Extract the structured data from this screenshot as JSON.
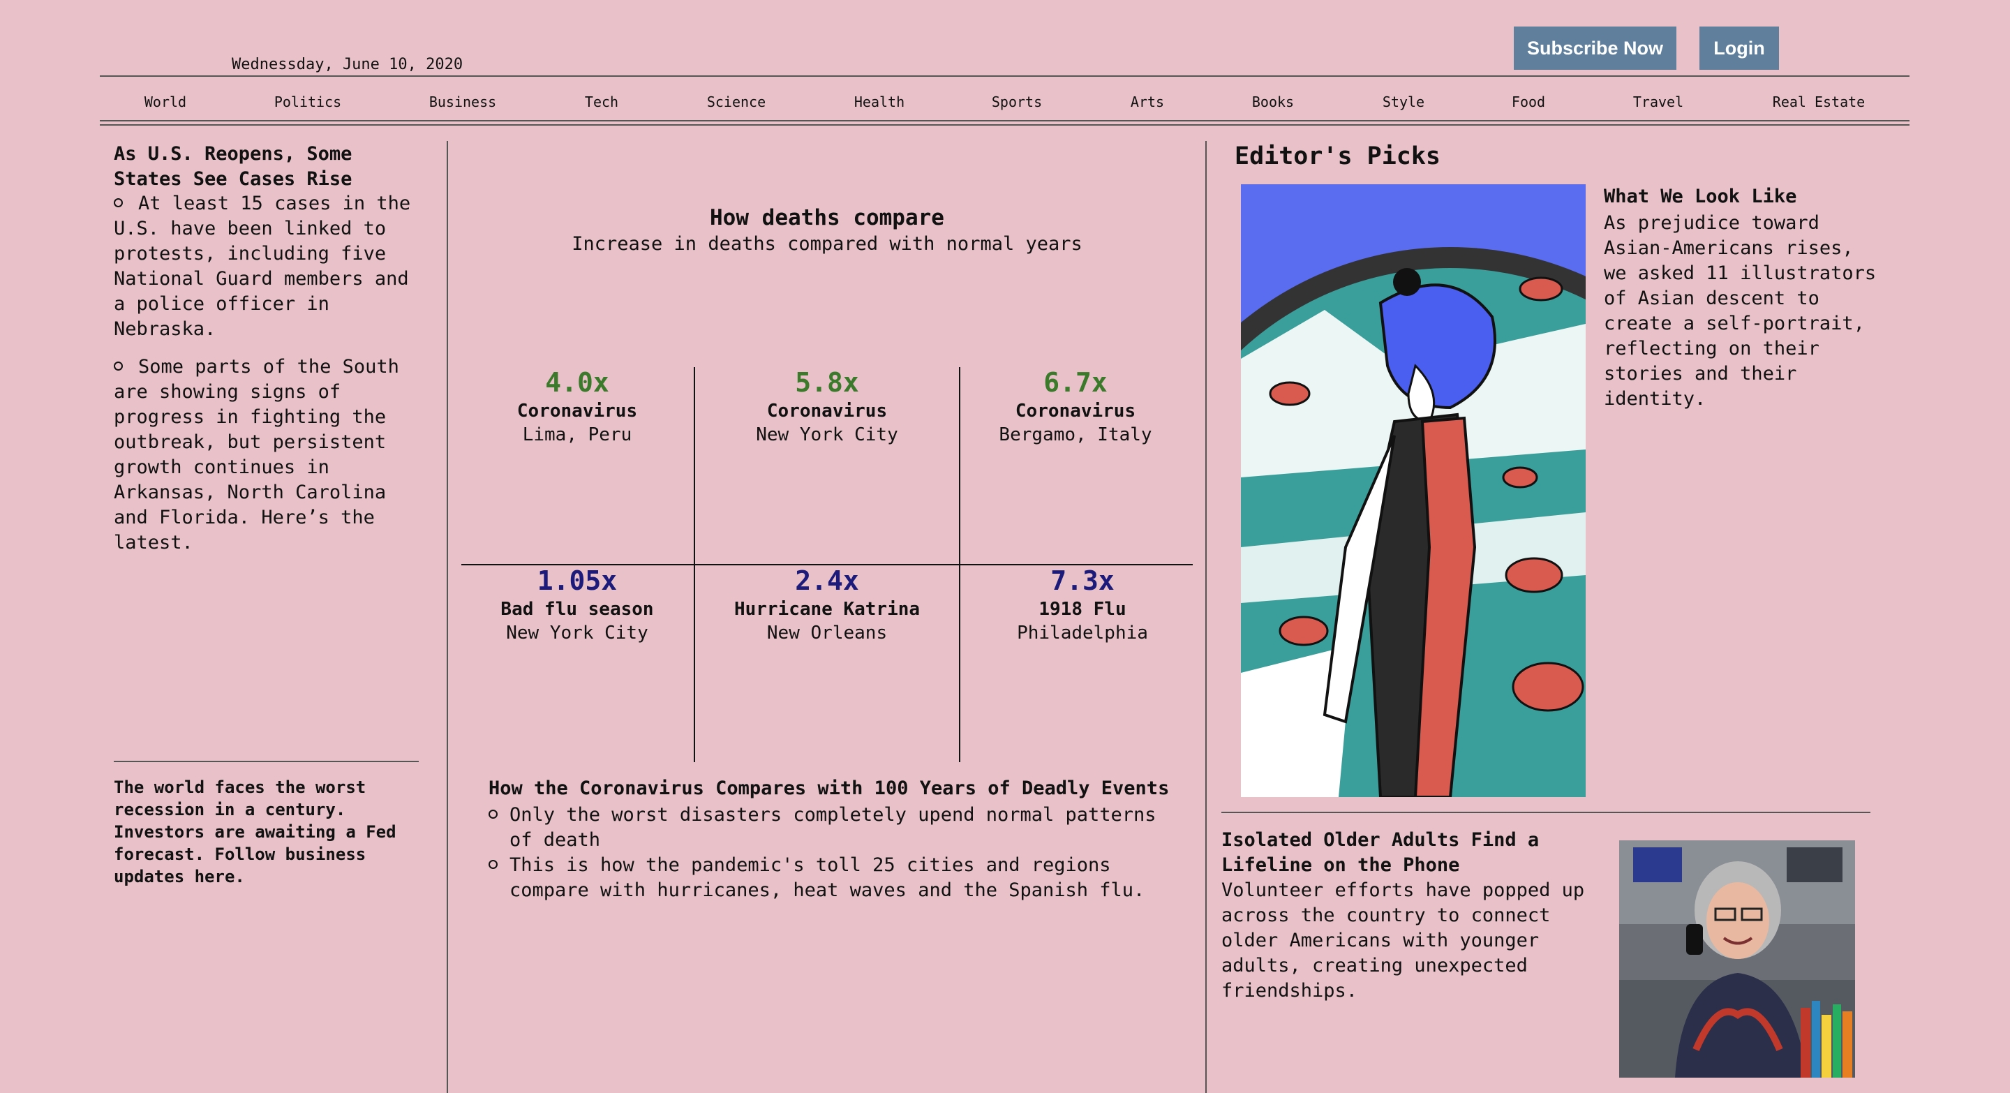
{
  "header": {
    "date": "Wednessday, June 10, 2020",
    "subscribe_label": "Subscribe Now",
    "login_label": "Login",
    "button_color": "#5f7f9c"
  },
  "nav": [
    "World",
    "Politics",
    "Business",
    "Tech",
    "Science",
    "Health",
    "Sports",
    "Arts",
    "Books",
    "Style",
    "Food",
    "Travel",
    "Real Estate"
  ],
  "left": {
    "headline": "As U.S. Reopens, Some States See Cases Rise",
    "bullets": [
      "At least 15 cases in the U.S. have been linked to protests, including five National Guard members and a police officer in Nebraska.",
      "Some parts of the South are showing signs of progress in fighting the outbreak, but persistent growth continues in Arkansas, North Carolina and Florida. Here’s the latest."
    ],
    "footer": "The world faces the worst recession in a century. Investors are awaiting a Fed forecast. Follow business updates here."
  },
  "chart": {
    "title": "How deaths compare",
    "subtitle": "Increase in deaths compared with normal years",
    "cells": [
      {
        "value": "4.0x",
        "label": "Coronavirus",
        "place": "Lima, Peru"
      },
      {
        "value": "5.8x",
        "label": "Coronavirus",
        "place": "New York City"
      },
      {
        "value": "6.7x",
        "label": "Coronavirus",
        "place": "Bergamo, Italy"
      },
      {
        "value": "1.05x",
        "label": "Bad flu season",
        "place": "New York City"
      },
      {
        "value": "2.4x",
        "label": "Hurricane Katrina",
        "place": "New Orleans"
      },
      {
        "value": "7.3x",
        "label": "1918 Flu",
        "place": "Philadelphia"
      }
    ],
    "top_color": "#3a7a2a",
    "bottom_color": "#1c1a7a"
  },
  "article": {
    "headline": "How the Coronavirus Compares with 100 Years of Deadly Events",
    "bullets": [
      "Only the worst disasters completely upend normal patterns of death",
      "This is how the pandemic's toll 25 cities and regions compare with hurricanes, heat waves and the Spanish flu."
    ]
  },
  "editors_picks": {
    "title": "Editor's Picks",
    "story1": {
      "headline": "What We Look Like",
      "body": "As prejudice toward Asian-Americans rises, we asked 11 illustrators of Asian descent to create a self-portrait, reflecting on their stories and their identity."
    },
    "story2": {
      "headline": "Isolated Older Adults Find a Lifeline on the Phone",
      "body": "Volunteer efforts have popped up across the country to connect older Americans with younger adults, creating unexpected friendships."
    }
  }
}
